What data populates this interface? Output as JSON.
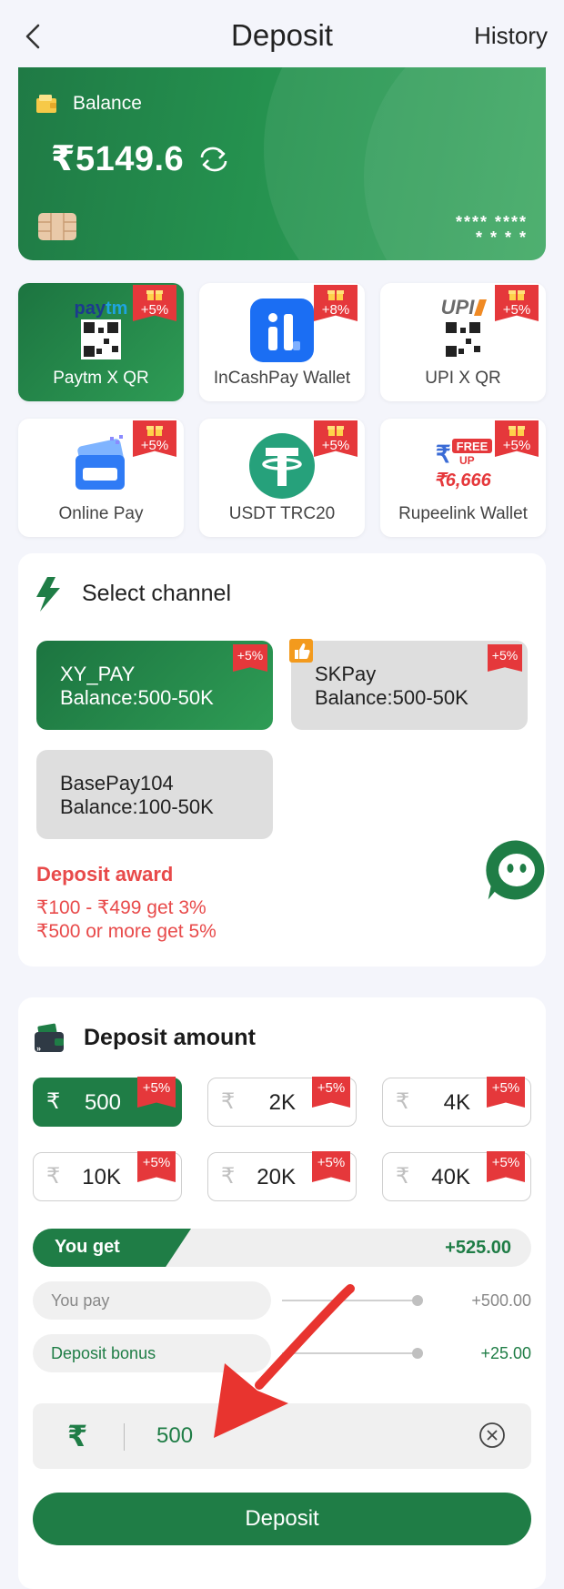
{
  "header": {
    "title": "Deposit",
    "history_label": "History"
  },
  "balance_card": {
    "label": "Balance",
    "amount": "₹5149.6",
    "mask_line1": "**** ****",
    "mask_line2": "* * * *"
  },
  "payment_methods": [
    {
      "label": "Paytm X QR",
      "badge": "+5%",
      "logo": "paytm-qr-icon",
      "active": true
    },
    {
      "label": "InCashPay Wallet",
      "badge": "+8%",
      "logo": "incashpay-icon",
      "active": false
    },
    {
      "label": "UPI X QR",
      "badge": "+5%",
      "logo": "upi-qr-icon",
      "active": false
    },
    {
      "label": "Online Pay",
      "badge": "+5%",
      "logo": "card-icon",
      "active": false
    },
    {
      "label": "USDT TRC20",
      "badge": "+5%",
      "logo": "tether-icon",
      "active": false
    },
    {
      "label": "Rupeelink Wallet",
      "badge": "+5%",
      "logo": "rupeelink-icon",
      "active": false
    }
  ],
  "channel": {
    "title": "Select channel",
    "options": [
      {
        "name": "XY_PAY",
        "balance": "Balance:500-50K",
        "badge": "+5%",
        "active": true
      },
      {
        "name": "SKPay",
        "balance": "Balance:500-50K",
        "badge": "+5%",
        "active": false
      },
      {
        "name": "BasePay104",
        "balance": "Balance:100-50K",
        "badge": "",
        "active": false
      }
    ],
    "award_title": "Deposit award",
    "award_lines": [
      "₹100 - ₹499 get 3%",
      "₹500 or more get 5%"
    ]
  },
  "amount": {
    "title": "Deposit amount",
    "currency_symbol": "₹",
    "options": [
      {
        "value": "500",
        "badge": "+5%",
        "active": true
      },
      {
        "value": "2K",
        "badge": "+5%",
        "active": false
      },
      {
        "value": "4K",
        "badge": "+5%",
        "active": false
      },
      {
        "value": "10K",
        "badge": "+5%",
        "active": false
      },
      {
        "value": "20K",
        "badge": "+5%",
        "active": false
      },
      {
        "value": "40K",
        "badge": "+5%",
        "active": false
      }
    ],
    "you_get_label": "You get",
    "you_get_value": "+525.00",
    "you_pay_label": "You pay",
    "you_pay_value": "+500.00",
    "bonus_label": "Deposit bonus",
    "bonus_value": "+25.00",
    "input_value": "500",
    "deposit_button": "Deposit"
  },
  "colors": {
    "brand_green": "#1f7d46",
    "award_red": "#e84a4a",
    "badge_red": "#e5383b"
  }
}
